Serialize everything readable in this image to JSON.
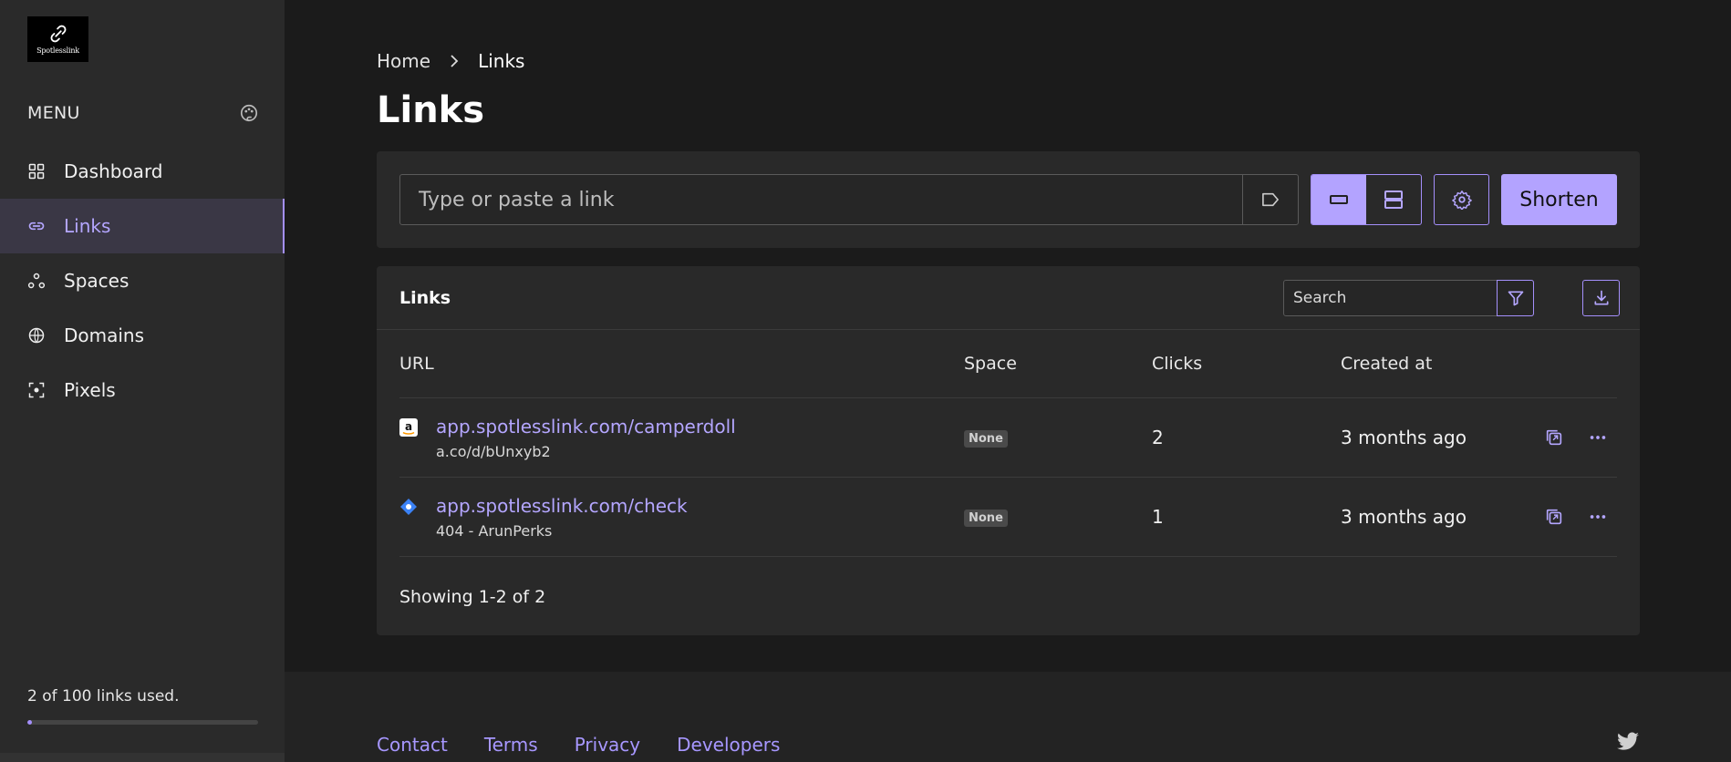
{
  "sidebar": {
    "logo_text": "Spotlesslink",
    "menu_title": "MENU",
    "items": [
      {
        "label": "Dashboard",
        "icon": "grid-icon"
      },
      {
        "label": "Links",
        "icon": "link-icon",
        "active": true
      },
      {
        "label": "Spaces",
        "icon": "spaces-icon"
      },
      {
        "label": "Domains",
        "icon": "globe-icon"
      },
      {
        "label": "Pixels",
        "icon": "pixel-icon"
      }
    ],
    "usage_text": "2 of 100 links used.",
    "usage_fraction": 0.02
  },
  "breadcrumb": {
    "home": "Home",
    "current": "Links"
  },
  "page_title": "Links",
  "shorten": {
    "placeholder": "Type or paste a link",
    "button_label": "Shorten"
  },
  "links_panel": {
    "title": "Links",
    "search_placeholder": "Search",
    "columns": [
      "URL",
      "Space",
      "Clicks",
      "Created at"
    ],
    "rows": [
      {
        "url": "app.spotlesslink.com/camperdoll",
        "sub": "a.co/d/bUnxyb2",
        "space": "None",
        "clicks": "2",
        "created": "3 months ago",
        "favicon": "amazon-icon"
      },
      {
        "url": "app.spotlesslink.com/check",
        "sub": "404 - ArunPerks",
        "space": "None",
        "clicks": "1",
        "created": "3 months ago",
        "favicon": "diamond-icon"
      }
    ],
    "showing": "Showing 1-2 of 2"
  },
  "footer": {
    "links": [
      "Contact",
      "Terms",
      "Privacy",
      "Developers"
    ]
  },
  "colors": {
    "accent": "#a48ffb",
    "background": "#1b1b1b",
    "panel": "#292929"
  }
}
